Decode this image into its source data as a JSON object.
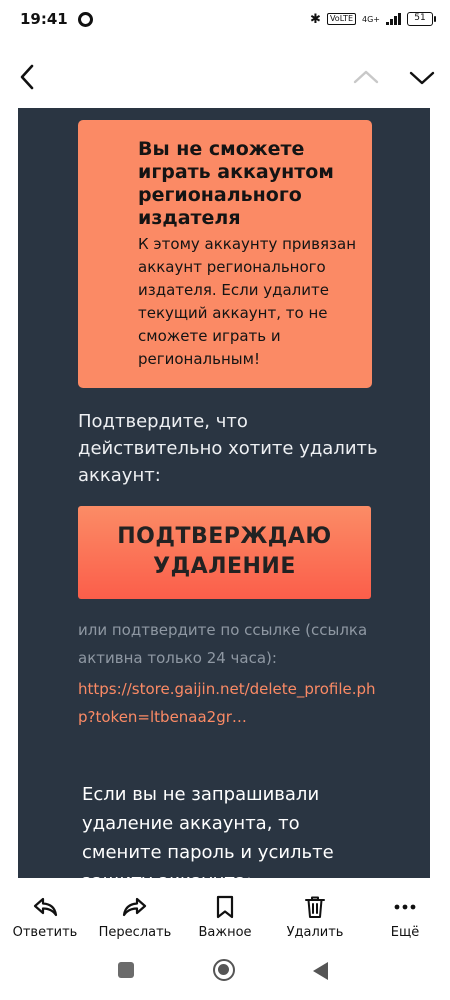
{
  "status_bar": {
    "time": "19:41",
    "network_box": "VoLTE",
    "network_type": "4G+",
    "battery": "51"
  },
  "email": {
    "warning_title": "Вы не сможете играть аккаунтом регионального издателя",
    "warning_text": "К этому аккаунту привязан аккаунт регионального издателя. Если удалите текущий аккаунт, то не сможете играть и региональным!",
    "confirm_prompt": "Подтвердите, что действительно хотите удалить аккаунт:",
    "confirm_button_label": "ПОДТВЕРЖДАЮ УДАЛЕНИЕ",
    "alt_confirm_text": "или подтвердите по ссылке (ссылка активна только 24 часа):",
    "delete_link": "https://store.gaijin.net/delete_profile.php?token=ltbenaa2gr…",
    "security_text": "Если вы не запрашивали удаление аккаунта, то смените пароль и усильте защиту аккаунта:"
  },
  "actions": {
    "reply": "Ответить",
    "forward": "Переслать",
    "important": "Важное",
    "delete": "Удалить",
    "more": "Ещё"
  },
  "colors": {
    "panel": "#2a3542",
    "accent": "#fb8a65",
    "button_bottom": "#fb5e4a"
  }
}
